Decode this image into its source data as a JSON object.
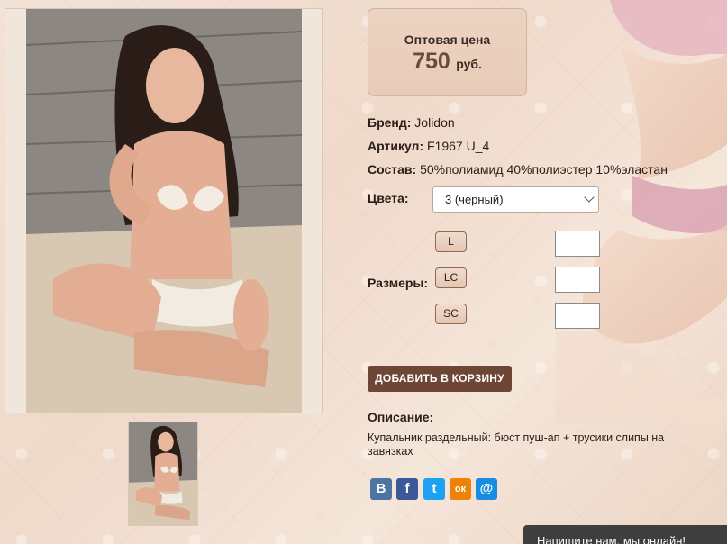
{
  "product": {
    "price_label": "Оптовая цена",
    "price_value": "750",
    "price_currency": "руб.",
    "brand_label": "Бренд:",
    "brand_value": "Jolidon",
    "article_label": "Артикул:",
    "article_value": "F1967 U_4",
    "composition_label": "Состав:",
    "composition_value": "50%полиамид 40%полиэстер 10%эластан",
    "colors_label": "Цвета:",
    "color_selected": "3 (черный)",
    "sizes_label": "Размеры:",
    "sizes": [
      {
        "label": "L",
        "qty": ""
      },
      {
        "label": "LC",
        "qty": ""
      },
      {
        "label": "SC",
        "qty": ""
      }
    ],
    "add_to_cart_label": "ДОБАВИТЬ В КОРЗИНУ",
    "description_label": "Описание:",
    "description_text": "Купальник раздельный: бюст пуш-ап + трусики слипы на завязках"
  },
  "social": {
    "vk_glyph": "В",
    "fb_glyph": "f",
    "tw_glyph": "t",
    "ok_glyph": "ок",
    "mr_glyph": "@"
  },
  "chat": {
    "label": "Напишите нам, мы онлайн!"
  },
  "icons": [
    "chevron-down-icon",
    "vk-icon",
    "facebook-icon",
    "twitter-icon",
    "odnoklassniki-icon",
    "mailru-icon"
  ],
  "colors": {
    "accent_brown": "#6d4636",
    "price_bg": "#ecd3c1",
    "chat_bg": "#3e3e3e"
  }
}
